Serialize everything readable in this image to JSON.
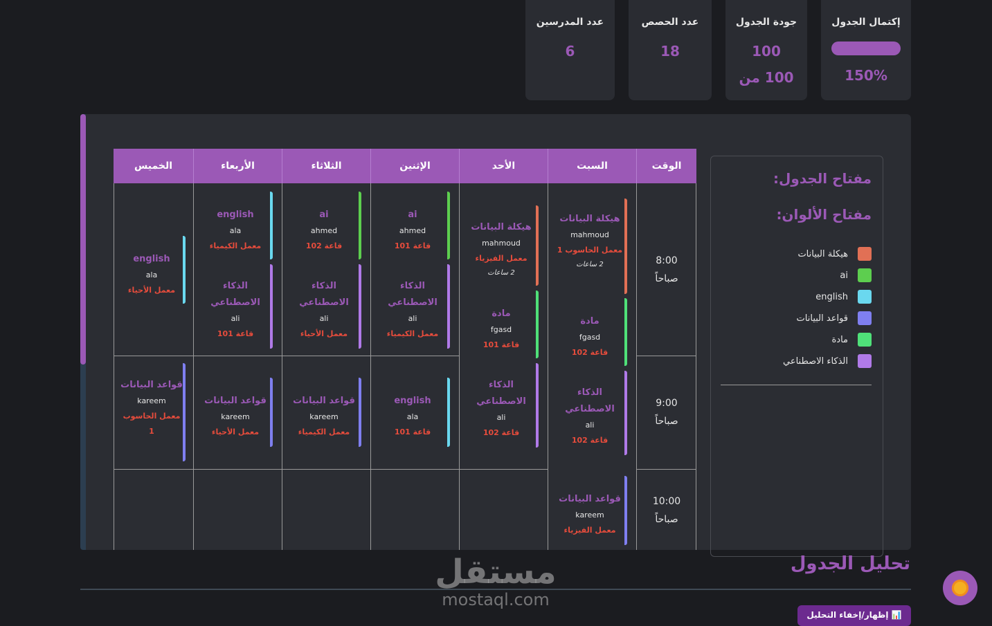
{
  "stats": {
    "completion": {
      "title": "إكتمال الجدول",
      "value": "150%",
      "progress_percent": 150
    },
    "quality": {
      "title": "جودة الجدول",
      "value": "100",
      "sub": "100 من"
    },
    "sessions": {
      "title": "عدد الحصص",
      "value": "18"
    },
    "teachers": {
      "title": "عدد المدرسين",
      "value": "6"
    }
  },
  "table": {
    "headers": {
      "time": "الوقت",
      "sat": "السبت",
      "sun": "الأحد",
      "mon": "الإثنين",
      "tue": "الثلاثاء",
      "wed": "الأربعاء",
      "thu": "الخميس"
    },
    "times": [
      {
        "time": "8:00",
        "period": "صباحاً"
      },
      {
        "time": "9:00",
        "period": "صباحاً"
      },
      {
        "time": "10:00",
        "period": "صباحاً"
      }
    ],
    "entries": {
      "sat1": {
        "subject": "هيكلة البيانات",
        "teacher": "mahmoud",
        "room": "معمل الحاسوب 1",
        "duration": "2 ساعات"
      },
      "sat2": {
        "subject": "مادة",
        "teacher": "fgasd",
        "room": "قاعة 102"
      },
      "sat3": {
        "subject": "الذكاء الاصطناعي",
        "teacher": "ali",
        "room": "قاعة 102"
      },
      "sat4": {
        "subject": "قواعد البيانات",
        "teacher": "kareem",
        "room": "معمل الفيزياء"
      },
      "sun1": {
        "subject": "هيكلة البيانات",
        "teacher": "mahmoud",
        "room": "معمل الفيزياء",
        "duration": "2 ساعات"
      },
      "sun2": {
        "subject": "مادة",
        "teacher": "fgasd",
        "room": "قاعة 101"
      },
      "sun3": {
        "subject": "الذكاء الاصطناعي",
        "teacher": "ali",
        "room": "قاعة 102"
      },
      "mon1": {
        "subject": "ai",
        "teacher": "ahmed",
        "room": "قاعة 101"
      },
      "mon2": {
        "subject": "الذكاء الاصطناعي",
        "teacher": "ali",
        "room": "معمل الكيمياء"
      },
      "mon3": {
        "subject": "english",
        "teacher": "ala",
        "room": "قاعة 101"
      },
      "tue1": {
        "subject": "ai",
        "teacher": "ahmed",
        "room": "قاعة 102"
      },
      "tue2": {
        "subject": "الذكاء الاصطناعي",
        "teacher": "ali",
        "room": "معمل الأحياء"
      },
      "tue3": {
        "subject": "قواعد البيانات",
        "teacher": "kareem",
        "room": "معمل الكيمياء"
      },
      "wed1": {
        "subject": "english",
        "teacher": "ala",
        "room": "معمل الكيمياء"
      },
      "wed2": {
        "subject": "الذكاء الاصطناعي",
        "teacher": "ali",
        "room": "قاعة 101"
      },
      "wed3": {
        "subject": "قواعد البيانات",
        "teacher": "kareem",
        "room": "معمل الأحياء"
      },
      "thu1": {
        "subject": "english",
        "teacher": "ala",
        "room": "معمل الأحياء"
      },
      "thu2": {
        "subject": "قواعد البيانات",
        "teacher": "kareem",
        "room": "معمل الحاسوب 1"
      }
    }
  },
  "legend": {
    "title": "مفتاح الجدول:",
    "colors_title": "مفتاح الألوان:",
    "items": [
      {
        "label": "هيكلة البيانات",
        "color": "#e17055"
      },
      {
        "label": "ai",
        "color": "#5dce4f"
      },
      {
        "label": "english",
        "color": "#6ad8ef"
      },
      {
        "label": "قواعد البيانات",
        "color": "#7f7ff0"
      },
      {
        "label": "مادة",
        "color": "#4fe079"
      },
      {
        "label": "الذكاء الاصطناعي",
        "color": "#b07ae8"
      }
    ]
  },
  "analysis": {
    "title": "تحليل الجدول",
    "toggle_label": "📊 إظهار/إخفاء التحليل"
  },
  "watermark": {
    "ar": "مستقل",
    "en": "mostaql.com"
  },
  "colors": {
    "accent": "#9b59b6",
    "room": "#e74c3c",
    "background": "#1b1c20",
    "card": "#2a2c32"
  }
}
